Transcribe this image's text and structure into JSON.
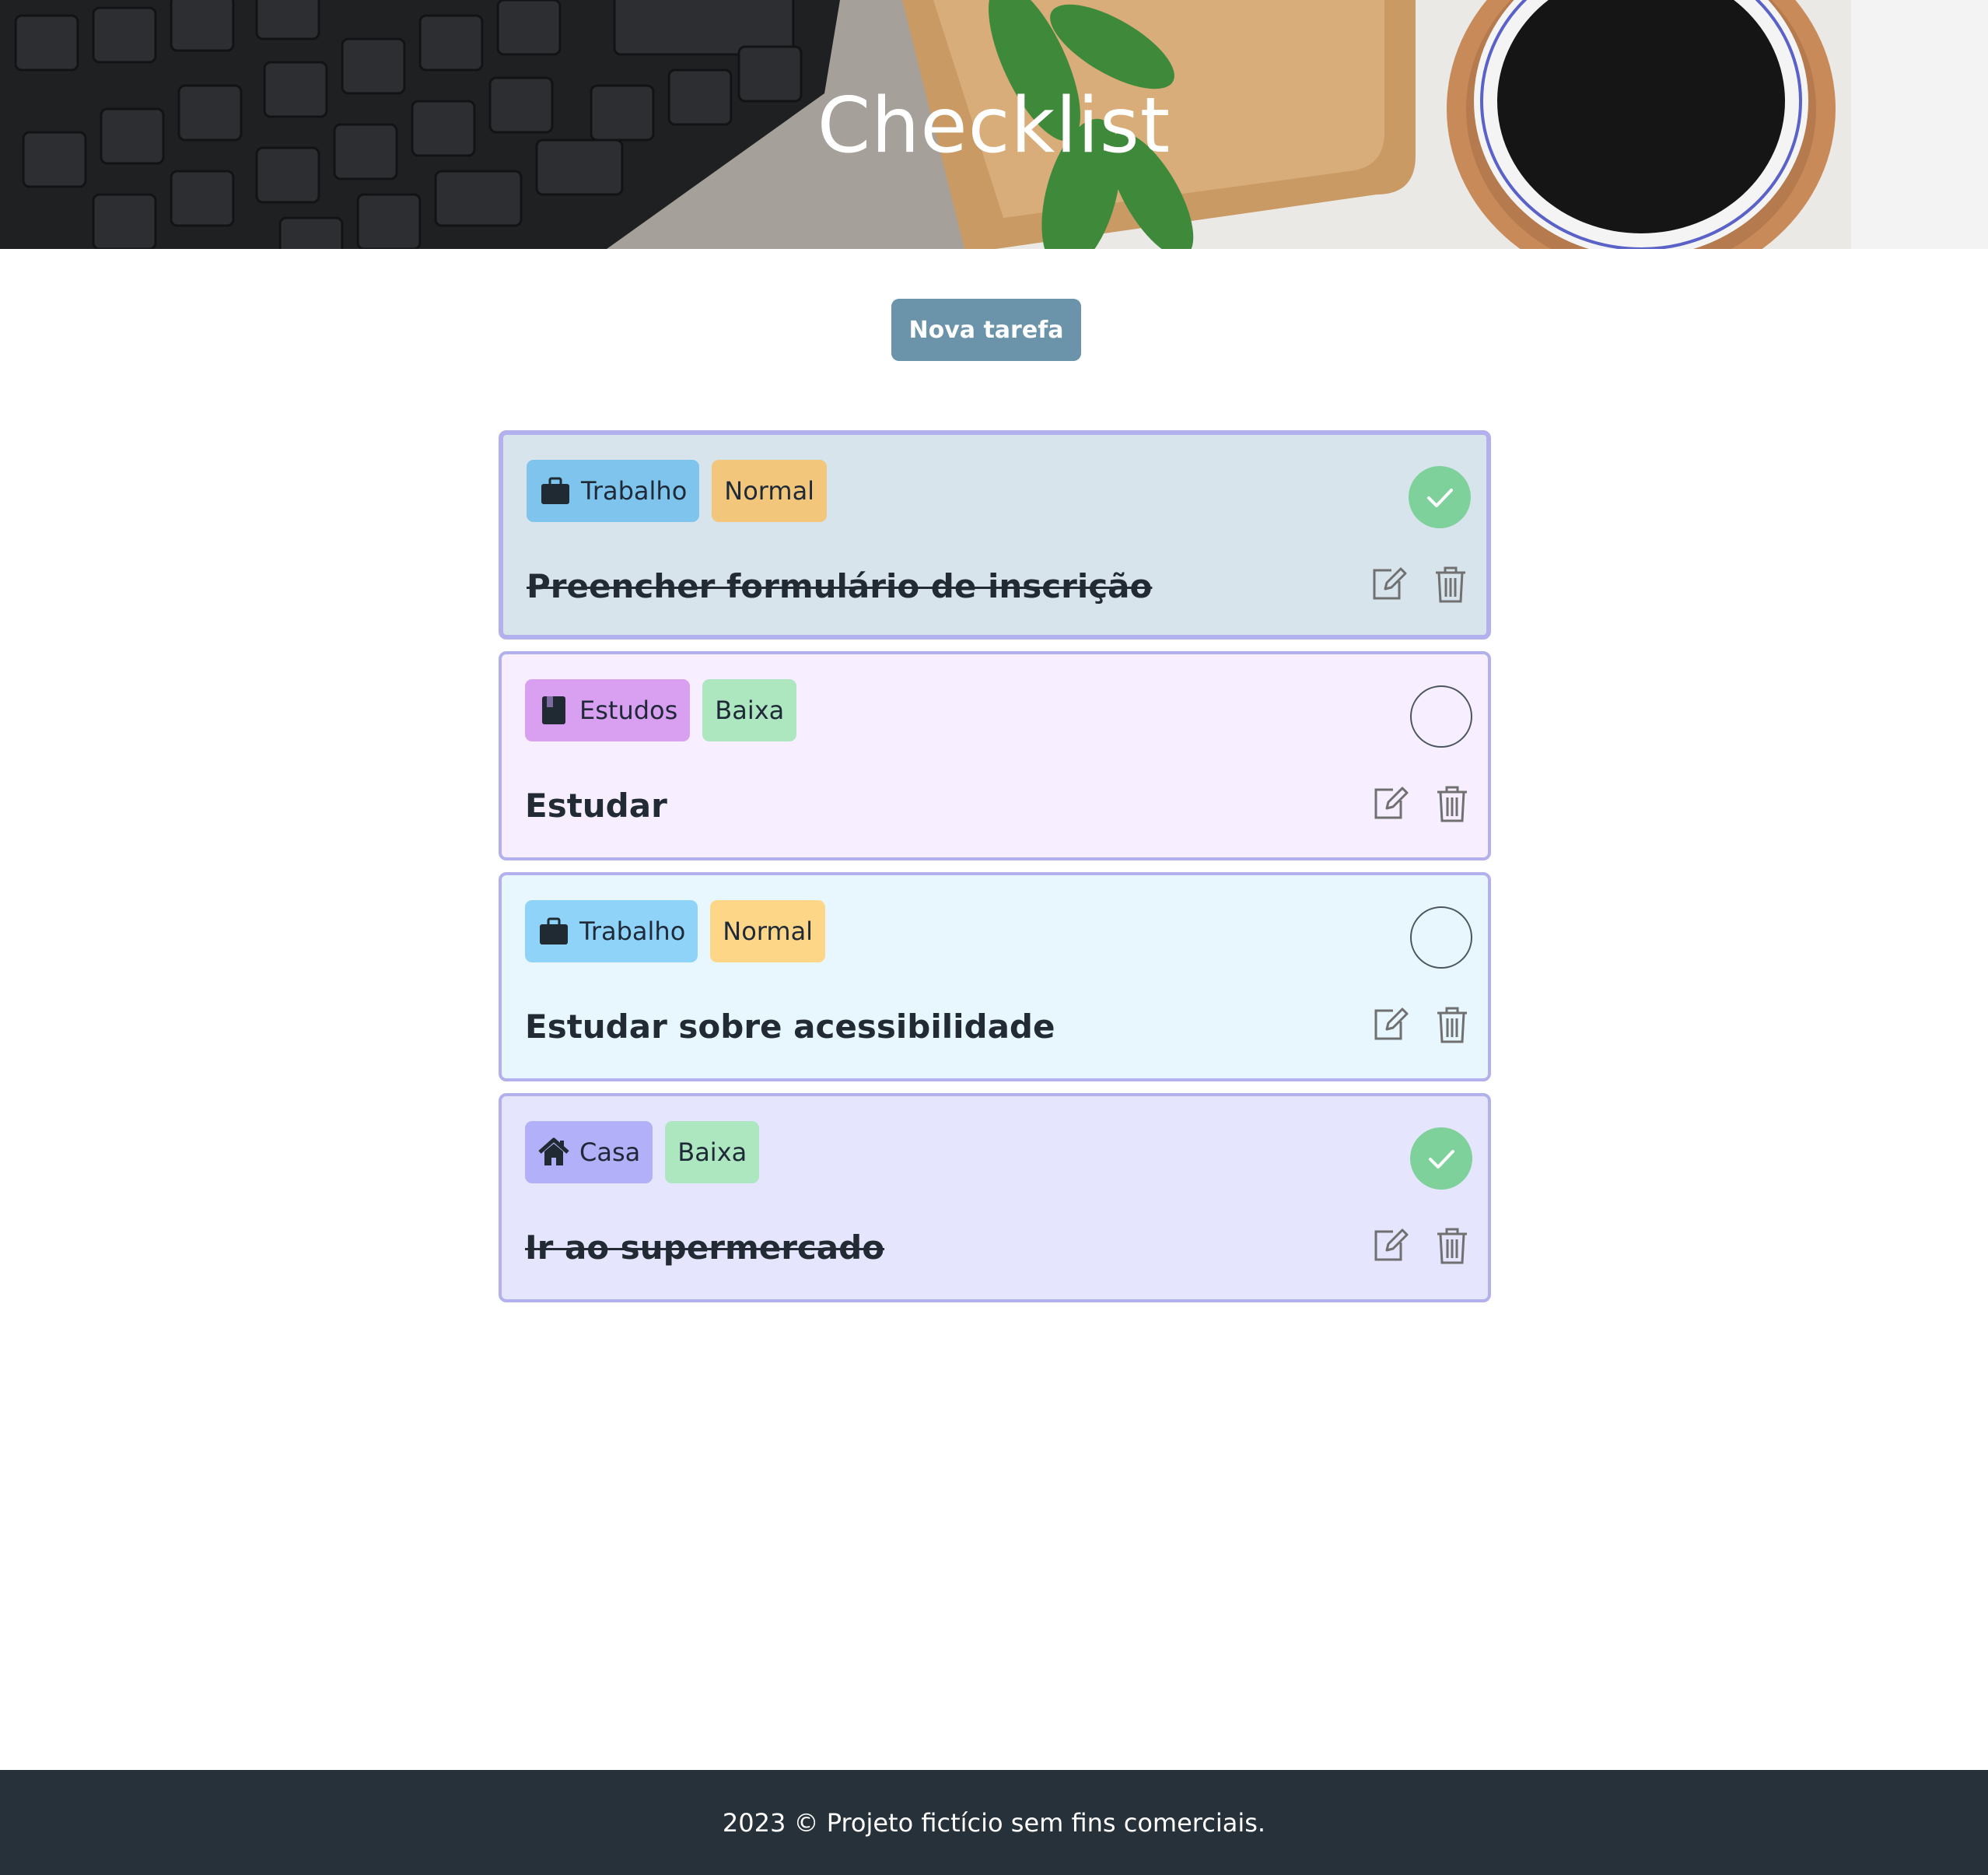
{
  "header": {
    "title": "Checklist"
  },
  "toolbar": {
    "new_task_label": "Nova tarefa"
  },
  "tasks": [
    {
      "category": "Trabalho",
      "category_icon": "briefcase-icon",
      "category_color": "#7ec4ec",
      "priority": "Normal",
      "priority_color": "#f2c77c",
      "title": "Preencher formulário de inscrição",
      "completed": true,
      "card_color": "#d8e4ec"
    },
    {
      "category": "Estudos",
      "category_icon": "book-icon",
      "category_color": "#d9a0f2",
      "priority": "Baixa",
      "priority_color": "#ade7bf",
      "title": "Estudar",
      "completed": false,
      "card_color": "#f7efff"
    },
    {
      "category": "Trabalho",
      "category_icon": "briefcase-icon",
      "category_color": "#8fd4f8",
      "priority": "Normal",
      "priority_color": "#fdd688",
      "title": "Estudar sobre acessibilidade",
      "completed": false,
      "card_color": "#e8f6fe"
    },
    {
      "category": "Casa",
      "category_icon": "house-icon",
      "category_color": "#b2b0f8",
      "priority": "Baixa",
      "priority_color": "#ade7bf",
      "title": "Ir ao supermercado",
      "completed": true,
      "card_color": "#e5e5fd"
    }
  ],
  "footer": {
    "text": "2023 © Projeto fictício sem fins comerciais."
  }
}
